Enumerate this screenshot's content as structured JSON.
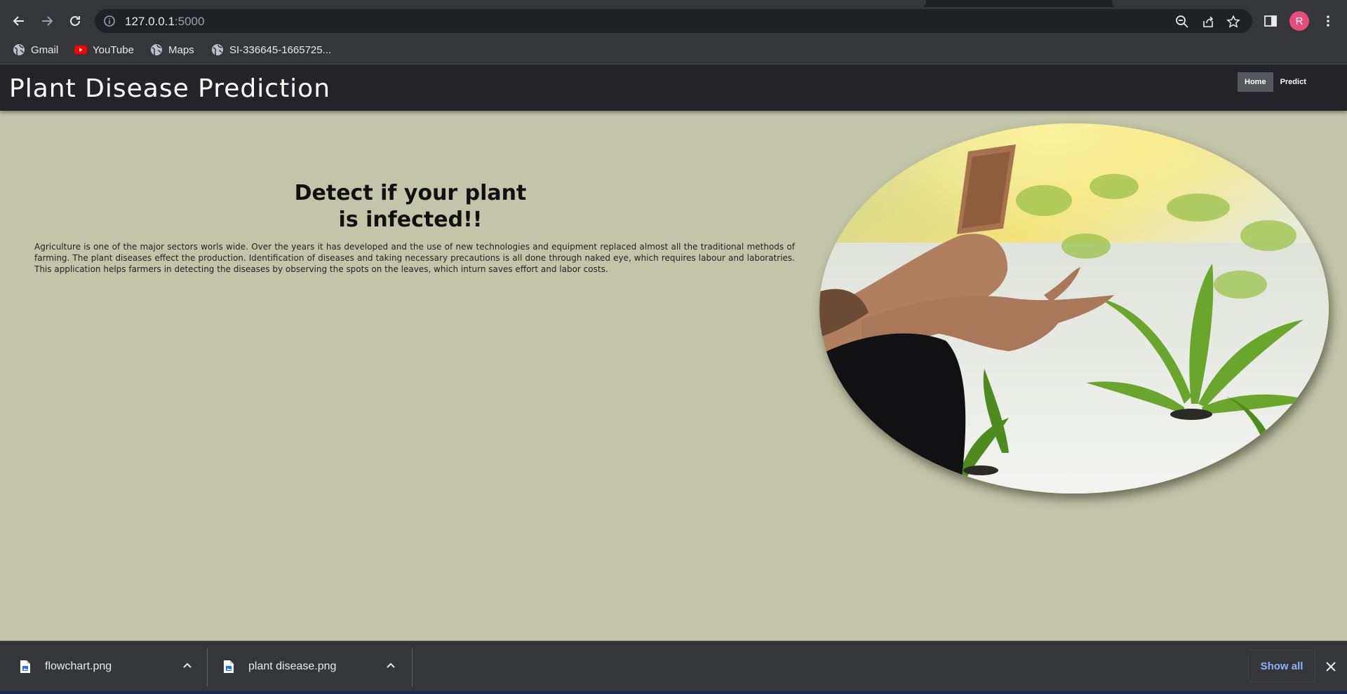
{
  "browser": {
    "url_host": "127.0.0.1",
    "url_port": ":5000",
    "profile_initial": "R",
    "bookmarks": [
      {
        "label": "Gmail",
        "icon": "globe-icon"
      },
      {
        "label": "YouTube",
        "icon": "youtube-icon"
      },
      {
        "label": "Maps",
        "icon": "globe-icon"
      },
      {
        "label": "SI-336645-1665725...",
        "icon": "globe-icon"
      }
    ]
  },
  "site": {
    "title": "Plant Disease Prediction",
    "nav": {
      "home": "Home",
      "predict": "Predict"
    },
    "hero": {
      "heading_line1": "Detect if your plant",
      "heading_line2": "is infected!!",
      "description": "Agriculture is one of the major sectors worls wide. Over the years it has developed and the use of new technologies and equipment replaced almost all the traditional methods of farming. The plant diseases effect the production. Identification of diseases and taking necessary precautions is all done through naked eye, which requires labour and laboratries. This application helps farmers in detecting the diseases by observing the spots on the leaves, which inturn saves effort and labor costs."
    }
  },
  "downloads": {
    "items": [
      {
        "name": "flowchart.png"
      },
      {
        "name": "plant disease.png"
      }
    ],
    "show_all": "Show all"
  },
  "colors": {
    "page_background": "#c2c5a8",
    "header_background": "#242428",
    "accent_link": "#8ab4f8",
    "avatar": "#e94b7d"
  }
}
